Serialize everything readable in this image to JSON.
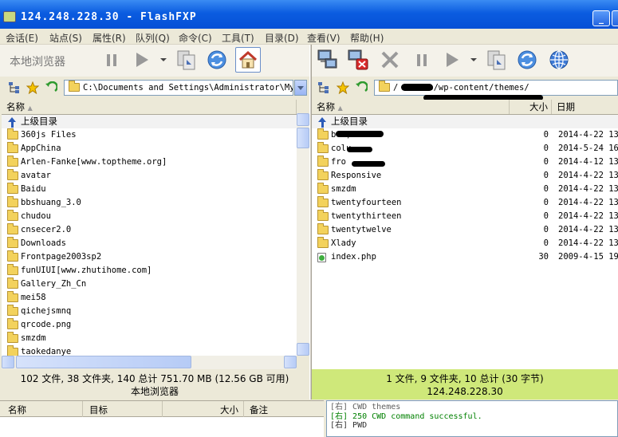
{
  "window": {
    "title": "124.248.228.30 - FlashFXP"
  },
  "menu": [
    "会话(E)",
    "站点(S)",
    "属性(R)",
    "队列(Q)",
    "命令(C)",
    "工具(T)",
    "目录(D)",
    "查看(V)",
    "帮助(H)"
  ],
  "left": {
    "toolbar_label": "本地浏览器",
    "path": "C:\\Documents and Settings\\Administrator\\My Do",
    "columns": {
      "name": "名称"
    },
    "parent_dir": "上级目录",
    "items": [
      "360js Files",
      "AppChina",
      "Arlen-Fanke[www.toptheme.org]",
      "avatar",
      "Baidu",
      "bbshuang_3.0",
      "chudou",
      "cnsecer2.0",
      "Downloads",
      "Frontpage2003sp2",
      "funUIUI[www.zhutihome.com]",
      "Gallery_Zh_Cn",
      "mei58",
      "qichejsmnq",
      "qrcode.png",
      "smzdm",
      "taokedanye"
    ],
    "status_line1": "102 文件, 38 文件夹, 140 总计 751.70 MB (12.56 GB 可用)",
    "status_line2": "本地浏览器"
  },
  "right": {
    "path": "/      38/web/wp-content/themes/",
    "columns": {
      "name": "名称",
      "size": "大小",
      "date": "日期"
    },
    "parent_dir": "上级目录",
    "items": [
      {
        "name": "b       1)",
        "size": "0",
        "date": "2014-4-22 13"
      },
      {
        "name": "colu",
        "size": "0",
        "date": "2014-5-24 16"
      },
      {
        "name": "fro",
        "size": "0",
        "date": "2014-4-12 13"
      },
      {
        "name": "Responsive",
        "size": "0",
        "date": "2014-4-22 13"
      },
      {
        "name": "smzdm",
        "size": "0",
        "date": "2014-4-22 13"
      },
      {
        "name": "twentyfourteen",
        "size": "0",
        "date": "2014-4-22 13"
      },
      {
        "name": "twentythirteen",
        "size": "0",
        "date": "2014-4-22 13"
      },
      {
        "name": "twentytwelve",
        "size": "0",
        "date": "2014-4-22 13"
      },
      {
        "name": "Xlady",
        "size": "0",
        "date": "2014-4-22 13"
      },
      {
        "name": "index.php",
        "size": "30",
        "date": "2009-4-15 19"
      }
    ],
    "status_line1": "1 文件, 9 文件夹, 10 总计 (30 字节)",
    "status_line2": "124.248.228.30"
  },
  "queue": {
    "columns": [
      "名称",
      "目标",
      "大小",
      "备注"
    ]
  },
  "log": [
    "[右] CWD themes",
    "[右] 250 CWD command successful.",
    "[右] PWD"
  ],
  "colors": {
    "titlebar": "#0550d6",
    "status_right_bg": "#CFE87A",
    "log_success": "#008000"
  }
}
